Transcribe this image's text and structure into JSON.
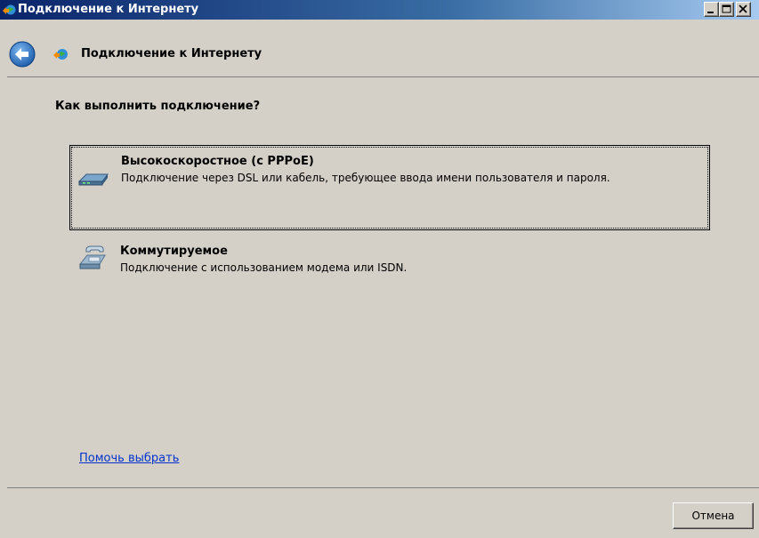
{
  "window": {
    "title": "Подключение к Интернету"
  },
  "header": {
    "title": "Подключение к Интернету"
  },
  "main": {
    "question": "Как выполнить подключение?",
    "options": [
      {
        "title": "Высокоскоростное (с PPPoE)",
        "description": "Подключение через DSL или кабель, требующее ввода имени пользователя и пароля.",
        "icon": "dsl-modem-icon",
        "selected": true
      },
      {
        "title": "Коммутируемое",
        "description": "Подключение с использованием модема или ISDN.",
        "icon": "dialup-modem-icon",
        "selected": false
      }
    ],
    "help_link": "Помочь выбрать"
  },
  "footer": {
    "cancel_label": "Отмена"
  },
  "colors": {
    "titlebar_start": "#0a246a",
    "titlebar_end": "#a6caf0",
    "background": "#d4d0c8",
    "link": "#0033cc"
  }
}
